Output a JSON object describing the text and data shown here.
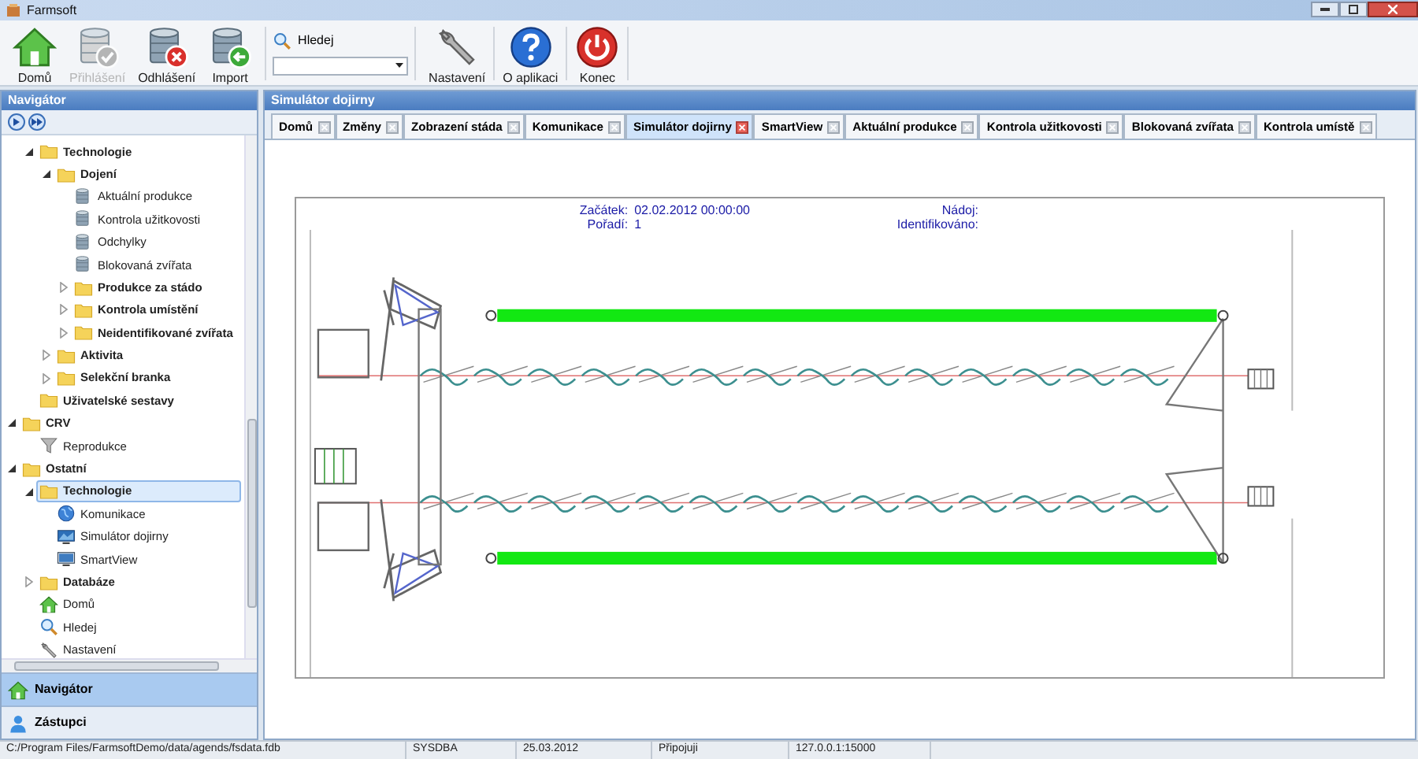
{
  "window": {
    "title": "Farmsoft"
  },
  "toolbar": {
    "buttons": [
      {
        "label": "Domů",
        "kind": "home",
        "disabled": false
      },
      {
        "label": "Přihlášení",
        "kind": "db-check",
        "disabled": true
      },
      {
        "label": "Odhlášení",
        "kind": "db-remove",
        "disabled": false
      },
      {
        "label": "Import",
        "kind": "db-import",
        "disabled": false
      }
    ],
    "search": {
      "label": "Hledej"
    },
    "buttons_right": [
      {
        "label": "Nastavení",
        "kind": "wrench",
        "disabled": false
      },
      {
        "label": "O aplikaci",
        "kind": "help",
        "disabled": false
      },
      {
        "label": "Konec",
        "kind": "power",
        "disabled": false
      }
    ]
  },
  "navigator": {
    "title": "Navigátor",
    "tree": {
      "hidden_parent_children": [
        {
          "label": "Technologie",
          "kind": "folder",
          "expanded": true,
          "selected": false,
          "children": [
            {
              "label": "Dojení",
              "kind": "folder",
              "expanded": true,
              "selected": false,
              "children": [
                {
                  "label": "Aktuální produkce",
                  "kind": "database",
                  "selected": false
                },
                {
                  "label": "Kontrola užitkovosti",
                  "kind": "database",
                  "selected": false
                },
                {
                  "label": "Odchylky",
                  "kind": "database",
                  "selected": false
                },
                {
                  "label": "Blokovaná zvířata",
                  "kind": "database",
                  "selected": false
                },
                {
                  "label": "Produkce za stádo",
                  "kind": "folder",
                  "expanded": false,
                  "selected": false
                },
                {
                  "label": "Kontrola umístění",
                  "kind": "folder",
                  "expanded": false,
                  "selected": false
                },
                {
                  "label": "Neidentifikované zvířata",
                  "kind": "folder",
                  "expanded": false,
                  "selected": false
                }
              ]
            },
            {
              "label": "Aktivita",
              "kind": "folder",
              "expanded": false,
              "selected": false
            },
            {
              "label": "Selekční branka",
              "kind": "folder",
              "expanded": false,
              "selected": false
            }
          ]
        },
        {
          "label": "Uživatelské sestavy",
          "kind": "folder",
          "selected": false
        }
      ],
      "items": [
        {
          "label": "CRV",
          "kind": "folder",
          "expanded": true,
          "selected": false,
          "children": [
            {
              "label": "Reprodukce",
              "kind": "funnel",
              "selected": false
            }
          ]
        },
        {
          "label": "Ostatní",
          "kind": "folder",
          "expanded": true,
          "selected": false,
          "children": [
            {
              "label": "Technologie",
              "kind": "folder",
              "expanded": true,
              "selected": true,
              "children": [
                {
                  "label": "Komunikace",
                  "kind": "globe",
                  "selected": false
                },
                {
                  "label": "Simulátor dojirny",
                  "kind": "monitor-sim",
                  "selected": false
                },
                {
                  "label": "SmartView",
                  "kind": "monitor",
                  "selected": false
                }
              ]
            },
            {
              "label": "Databáze",
              "kind": "folder",
              "expanded": false,
              "selected": false
            },
            {
              "label": "Domů",
              "kind": "home",
              "selected": false
            },
            {
              "label": "Hledej",
              "kind": "search",
              "selected": false
            },
            {
              "label": "Nastavení",
              "kind": "wrench",
              "selected": false
            }
          ]
        }
      ]
    },
    "bottom_buttons": [
      {
        "label": "Navigátor",
        "kind": "home",
        "selected": true
      },
      {
        "label": "Zástupci",
        "kind": "person",
        "selected": false
      }
    ]
  },
  "document": {
    "title": "Simulátor dojirny",
    "tabs": [
      {
        "label": "Domů",
        "selected": false
      },
      {
        "label": "Změny",
        "selected": false
      },
      {
        "label": "Zobrazení stáda",
        "selected": false
      },
      {
        "label": "Komunikace",
        "selected": false
      },
      {
        "label": "Simulátor dojirny",
        "selected": true
      },
      {
        "label": "SmartView",
        "selected": false
      },
      {
        "label": "Aktuální produkce",
        "selected": false
      },
      {
        "label": "Kontrola užitkovosti",
        "selected": false
      },
      {
        "label": "Blokovaná zvířata",
        "selected": false
      },
      {
        "label": "Kontrola umístě",
        "selected": false
      }
    ],
    "simulator": {
      "left_fields": [
        {
          "label": "Začátek:",
          "value": "02.02.2012 00:00:00"
        },
        {
          "label": "Pořadí:",
          "value": "1"
        }
      ],
      "right_fields": [
        {
          "label": "Nádoj:"
        },
        {
          "label": "Identifikováno:"
        }
      ]
    }
  },
  "status_bar": {
    "items": [
      "C:/Program Files/FarmsoftDemo/data/agends/fsdata.fdb",
      "SYSDBA",
      "25.03.2012",
      "Připojuji",
      "127.0.0.1:15000"
    ]
  }
}
